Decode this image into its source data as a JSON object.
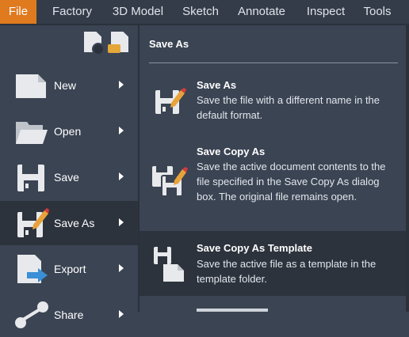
{
  "menubar": {
    "items": [
      {
        "label": "File",
        "active": true
      },
      {
        "label": "Factory"
      },
      {
        "label": "3D Model"
      },
      {
        "label": "Sketch"
      },
      {
        "label": "Annotate"
      },
      {
        "label": "Inspect"
      },
      {
        "label": "Tools"
      }
    ]
  },
  "sidebar": {
    "recent_icons": [
      "recent-documents-icon",
      "open-folder-documents-icon"
    ],
    "items": [
      {
        "label": "New",
        "icon": "new-document-icon"
      },
      {
        "label": "Open",
        "icon": "open-folder-icon"
      },
      {
        "label": "Save",
        "icon": "save-floppy-icon"
      },
      {
        "label": "Save As",
        "icon": "save-as-icon",
        "active": true
      },
      {
        "label": "Export",
        "icon": "export-icon"
      },
      {
        "label": "Share",
        "icon": "share-icon"
      }
    ]
  },
  "panel": {
    "title": "Save As",
    "options": [
      {
        "title": "Save As",
        "desc": "Save the file with a different name in the default format.",
        "icon": "save-as-icon"
      },
      {
        "title": "Save Copy As",
        "desc": "Save the active document contents to the file specified in the Save Copy As dialog box. The original file remains open.",
        "icon": "save-copy-as-icon"
      },
      {
        "title": "Save Copy As Template",
        "desc": "Save the active file as a template in the template folder.",
        "icon": "save-copy-as-template-icon",
        "hover": true
      }
    ]
  },
  "colors": {
    "accent": "#e07a1f",
    "background": "#3b4453",
    "menubar": "#343c49",
    "highlight": "#2d333d"
  }
}
